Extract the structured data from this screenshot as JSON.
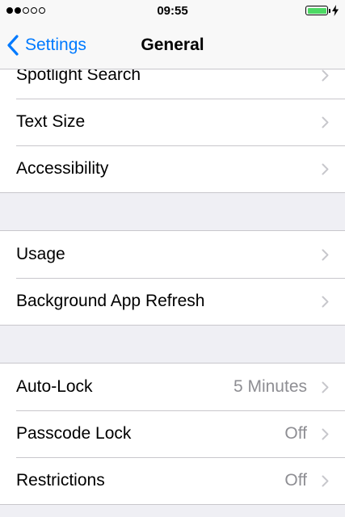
{
  "status_bar": {
    "time": "09:55",
    "signal_bars_filled": 2,
    "signal_bars_total": 5,
    "battery_level": 1.0,
    "battery_color": "#4cd964",
    "charging": true
  },
  "nav": {
    "back_label": "Settings",
    "title": "General",
    "accent_color": "#007aff"
  },
  "groups": [
    {
      "rows": [
        {
          "label": "Spotlight Search",
          "value": ""
        },
        {
          "label": "Text Size",
          "value": ""
        },
        {
          "label": "Accessibility",
          "value": ""
        }
      ]
    },
    {
      "rows": [
        {
          "label": "Usage",
          "value": ""
        },
        {
          "label": "Background App Refresh",
          "value": ""
        }
      ]
    },
    {
      "rows": [
        {
          "label": "Auto-Lock",
          "value": "5 Minutes"
        },
        {
          "label": "Passcode Lock",
          "value": "Off"
        },
        {
          "label": "Restrictions",
          "value": "Off"
        }
      ]
    }
  ]
}
